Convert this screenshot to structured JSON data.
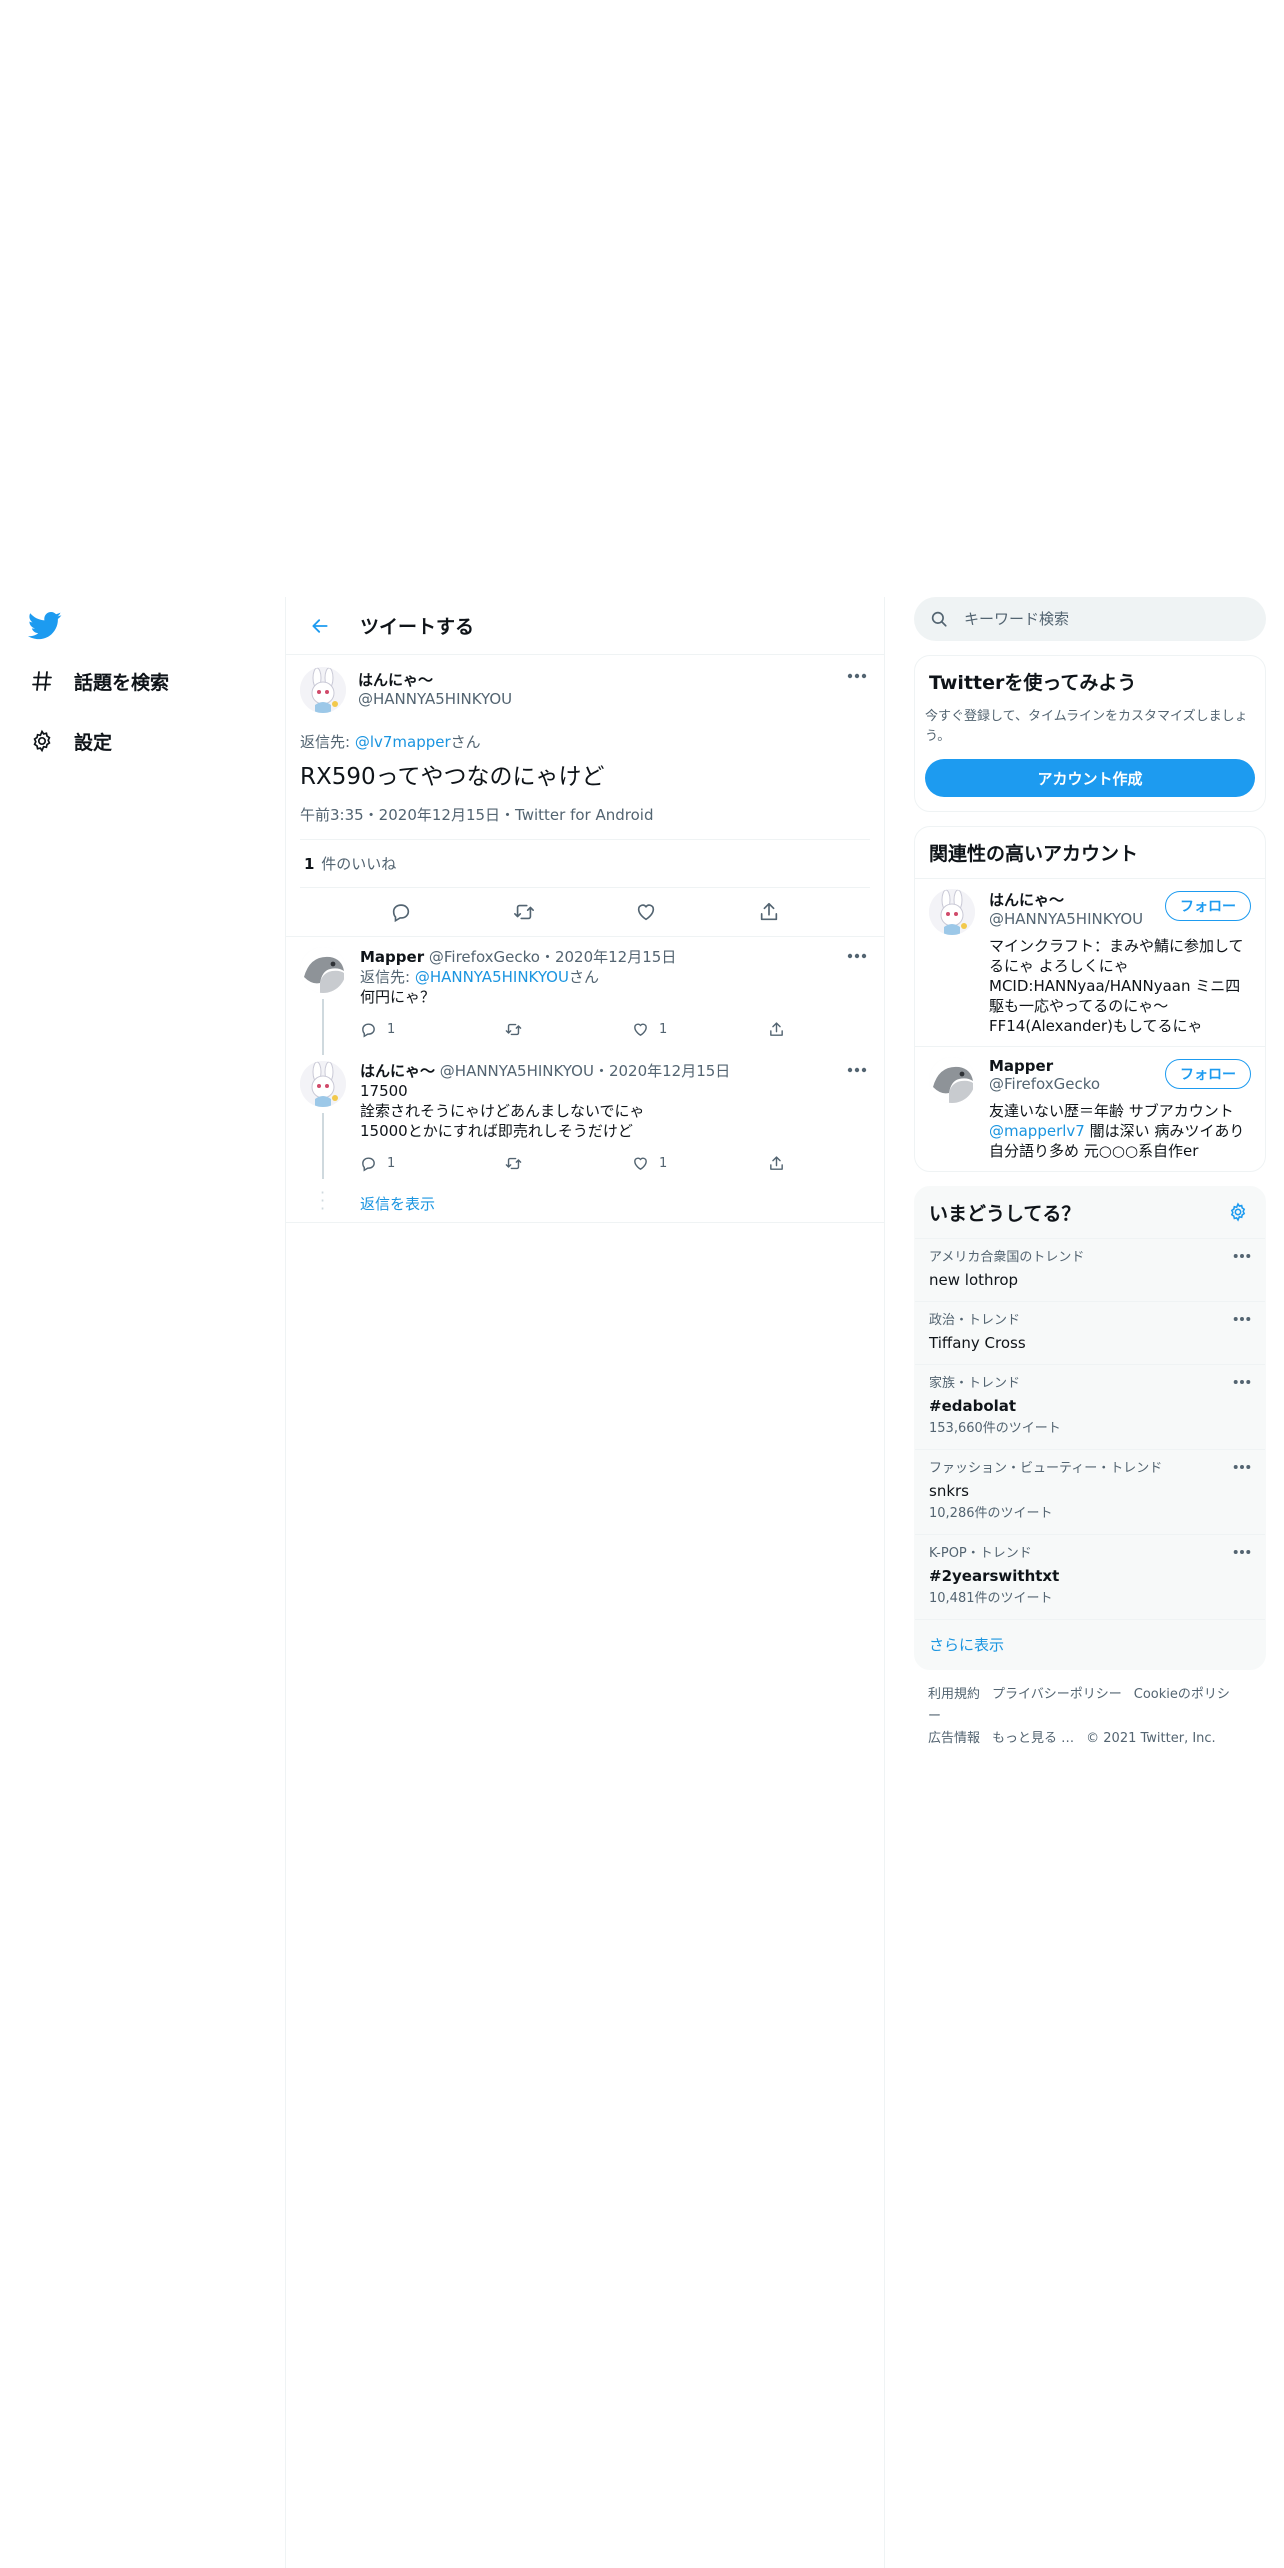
{
  "nav": {
    "logo": "twitter-bird-icon",
    "items": [
      {
        "label": "話題を検索",
        "icon": "hashtag-icon"
      },
      {
        "label": "設定",
        "icon": "gear-icon"
      }
    ]
  },
  "header": {
    "title": "ツイートする"
  },
  "main_tweet": {
    "name": "はんにゃ～",
    "handle": "@HANNYA5HINKYOU",
    "reply_prefix": "返信先: ",
    "reply_handle": "@lv7mapper",
    "reply_suffix": "さん",
    "text": "RX590ってやつなのにゃけど",
    "meta": "午前3:35・2020年12月15日・Twitter for Android",
    "likes_count": "1",
    "likes_label": "件のいいね"
  },
  "replies": [
    {
      "name": "Mapper",
      "handle": "@FirefoxGecko",
      "date": "・2020年12月15日",
      "reply_prefix": "返信先: ",
      "reply_handle": "@HANNYA5HINKYOU",
      "reply_suffix": "さん",
      "lines": [
        "何円にゃ？"
      ],
      "reply_count": "1",
      "retweet_count": "",
      "like_count": "1"
    },
    {
      "name": "はんにゃ～",
      "handle": "@HANNYA5HINKYOU",
      "date": "・2020年12月15日",
      "lines": [
        "17500",
        "詮索されそうにゃけどあんましないでにゃ",
        "15000とかにすれば即売れしそうだけど"
      ],
      "reply_count": "1",
      "retweet_count": "",
      "like_count": "1"
    }
  ],
  "show_replies": "返信を表示",
  "search": {
    "placeholder": "キーワード検索"
  },
  "signup": {
    "title": "Twitterを使ってみよう",
    "desc": "今すぐ登録して、タイムラインをカスタマイズしましょう。",
    "button": "アカウント作成"
  },
  "relevant": {
    "title": "関連性の高いアカウント",
    "follow_label": "フォロー",
    "accounts": [
      {
        "name": "はんにゃ～",
        "handle": "@HANNYA5HINKYOU",
        "bio": [
          "マインクラフト：まみや鯖に参加してるにゃ よろしくにゃ",
          "MCID:HANNyaa/HANNyaan ミニ四駆も一応やってるのにゃ～",
          "FF14(Alexander)もしてるにゃ"
        ]
      },
      {
        "name": "Mapper",
        "handle": "@FirefoxGecko",
        "bio_pre": "友達いない歴＝年齢 サブアカウント",
        "bio_link": "@mapperlv7",
        "bio_post": " 闇は深い 病みツイあり 自分語り多め 元○○○系自作er"
      }
    ]
  },
  "trends": {
    "title": "いまどうしてる？",
    "items": [
      {
        "context": "アメリカ合衆国のトレンド",
        "name": "new lothrop",
        "count": ""
      },
      {
        "context": "政治・トレンド",
        "name": "Tiffany Cross",
        "count": ""
      },
      {
        "context": "家族・トレンド",
        "name": "#edabolat",
        "count": "153,660件のツイート"
      },
      {
        "context": "ファッション・ビューティー・トレンド",
        "name": "snkrs",
        "count": "10,286件のツイート"
      },
      {
        "context": "K-POP・トレンド",
        "name": "#2yearswithtxt",
        "count": "10,481件のツイート"
      }
    ],
    "show_more": "さらに表示"
  },
  "footer": {
    "links": [
      "利用規約",
      "プライバシーポリシー",
      "Cookieのポリシー",
      "広告情報",
      "もっと見る …"
    ],
    "copyright": "© 2021 Twitter, Inc."
  },
  "colors": {
    "accent": "#1d9bf0",
    "text": "#0f1419",
    "secondary": "#536471",
    "border": "#eff3f4"
  }
}
